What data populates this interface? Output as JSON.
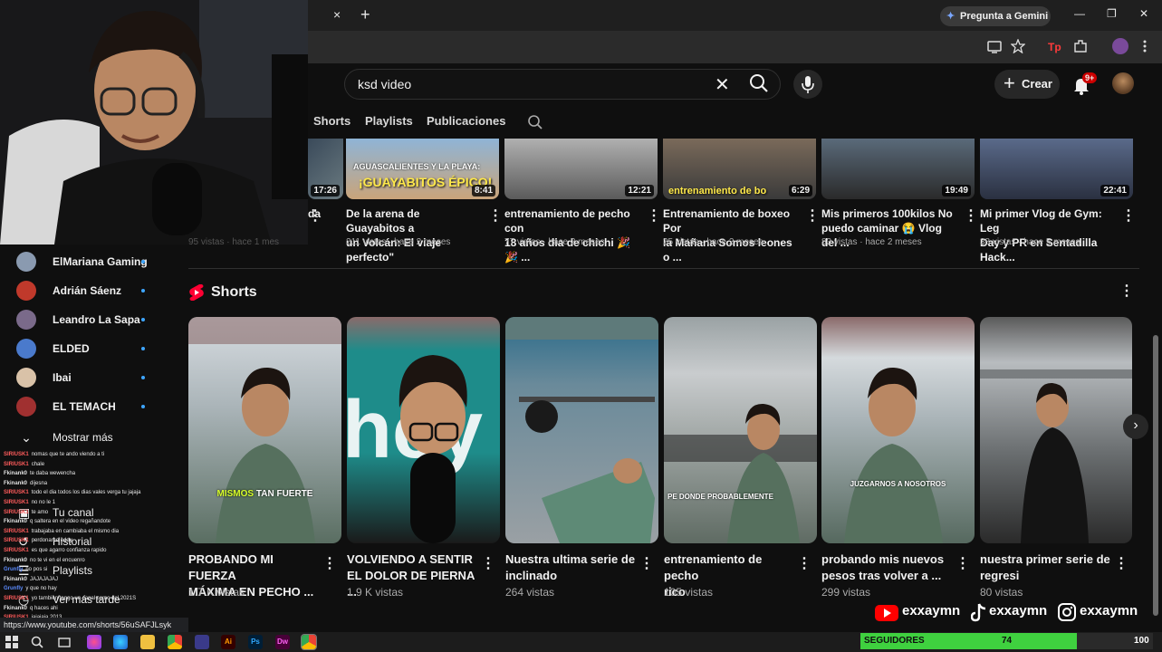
{
  "browser": {
    "new_tab": "+",
    "close_tab": "×",
    "gemini_label": "Pregunta a Gemini",
    "window_min": "—",
    "window_max": "❐",
    "window_close": "✕"
  },
  "youtube": {
    "search": {
      "value": "ksd video"
    },
    "create_label": "Crear",
    "notification_count": "9+",
    "channel_tabs": [
      "Shorts",
      "Playlists",
      "Publicaciones"
    ],
    "videos": [
      {
        "title_lines": [
          "",
          "da"
        ],
        "meta": "95 vistas · hace 1 mes",
        "duration": "17:26",
        "colors": [
          "#3a4a5a",
          "#6a7a80"
        ]
      },
      {
        "title_lines": [
          "De la arena de Guayabitos a",
          "un Volcán: El viaje perfecto\""
        ],
        "meta": "211 vistas · hace 2 meses",
        "duration": "8:41",
        "thumb_text_1": "AGUASCALIENTES Y LA PLAYA:",
        "thumb_text_2": "¡GUAYABITOS ÉPICO!",
        "colors": [
          "#8fb4d6",
          "#c9a47a"
        ]
      },
      {
        "title_lines": [
          "entrenamiento de pecho con",
          "18 años  dia de chichi 🎉 🎉 ..."
        ],
        "meta": "77 vistas · hace 2 meses",
        "duration": "12:21",
        "colors": [
          "#9a9a9a",
          "#5b5b5b"
        ]
      },
      {
        "title_lines": [
          "Entrenamiento de boxeo Por",
          "la Mañana Somos leones o ..."
        ],
        "meta": "25 vistas · hace 2 meses",
        "duration": "6:29",
        "thumb_text_1": "entrenamiento de bo",
        "colors": [
          "#7a6a5a",
          "#3a3a3a"
        ]
      },
      {
        "title_lines": [
          "Mis primeros 100kilos No",
          "puedo caminar 😭 Vlog del ..."
        ],
        "meta": "83 vistas · hace 2 meses",
        "duration": "19:49",
        "colors": [
          "#4a5a6a",
          "#2a2a2a"
        ]
      },
      {
        "title_lines": [
          "Mi primer Vlog de Gym: Leg",
          "Day y PR en Sentadilla Hack..."
        ],
        "meta": "38 vistas · hace 5 meses",
        "duration": "22:41",
        "colors": [
          "#5a6a8a",
          "#2a3040"
        ]
      }
    ],
    "shorts_heading": "Shorts",
    "shorts": [
      {
        "title_lines": [
          "PROBANDO MI FUERZA",
          "MÁXIMA EN PECHO ..."
        ],
        "views": "1.7 K vistas",
        "caption_a": "MISMOS",
        "caption_b": "TAN FUERTE",
        "colors": [
          "#d8dde2",
          "#5a6e62"
        ]
      },
      {
        "title_lines": [
          "VOLVIENDO A SENTIR",
          "EL DOLOR DE PIERNA ..."
        ],
        "views": "1.9 K vistas",
        "caption_a": "",
        "caption_b": "",
        "colors": [
          "#1e8c8a",
          "#1a1a1a"
        ]
      },
      {
        "title_lines": [
          "Nuestra ultima serie de",
          "inclinado"
        ],
        "views": "264 vistas",
        "caption_a": "",
        "caption_b": "",
        "colors": [
          "#2a6b8a",
          "#9aa0a4"
        ]
      },
      {
        "title_lines": [
          "entrenamiento de pecho",
          "rico"
        ],
        "views": "105 vistas",
        "caption_a": "",
        "caption_b": "PE DONDE PROBABLEMENTE",
        "colors": [
          "#c9ccce",
          "#5f6b63"
        ]
      },
      {
        "title_lines": [
          "probando mis nuevos",
          "pesos tras volver a ..."
        ],
        "views": "299 vistas",
        "caption_a": "",
        "caption_b": "JUZGARNOS A NOSOTROS",
        "colors": [
          "#d5dadd",
          "#56695f"
        ]
      },
      {
        "title_lines": [
          "nuestra primer serie de",
          "regresi"
        ],
        "views": "80 vistas",
        "caption_a": "",
        "caption_b": "",
        "colors": [
          "#b8bcbf",
          "#2a2a2a"
        ]
      }
    ]
  },
  "sidebar": {
    "subscriptions": [
      {
        "name": "ElMariana Gaming",
        "color": "#8a9ab0"
      },
      {
        "name": "Adrián Sáenz",
        "color": "#c0392b"
      },
      {
        "name": "Leandro La Sapa",
        "color": "#7a6a8a"
      },
      {
        "name": "ELDED",
        "color": "#4a7acc"
      },
      {
        "name": "Ibai",
        "color": "#d9c2a8"
      },
      {
        "name": "EL TEMACH",
        "color": "#a03030"
      }
    ],
    "show_more": "Mostrar más",
    "nav": [
      "Tu canal",
      "Historial",
      "Playlists",
      "Ver más tarde"
    ]
  },
  "chat": [
    {
      "user": "SIRIUSK1",
      "text": "nomas que te ando viendo a ti"
    },
    {
      "user": "SIRIUSK1",
      "text": "chale"
    },
    {
      "user": "Fkinank0",
      "text": "te daba wewencha"
    },
    {
      "user": "Fkinank0",
      "text": "dijesna"
    },
    {
      "user": "SIRIUSK1",
      "text": "todo el dia todos los dias vales verga tu jajaja"
    },
    {
      "user": "SIRIUSK1",
      "text": "no no le 1"
    },
    {
      "user": "SIRIUSK1",
      "text": "te amo"
    },
    {
      "user": "Fkinank0",
      "text": "q saltera en el video regañandote"
    },
    {
      "user": "SIRIUSK1",
      "text": "trabajaba en cambiaba el mismo dia"
    },
    {
      "user": "SIRIUSK1",
      "text": "perdoname eddy"
    },
    {
      "user": "SIRIUSK1",
      "text": "es que agarro confianza rapido"
    },
    {
      "user": "Fkinank0",
      "text": "no te vi en el encuenro"
    },
    {
      "user": "Grunfly",
      "text": "no pos si"
    },
    {
      "user": "Fkinank0",
      "text": "JAJAJAJAJ"
    },
    {
      "user": "Grunfly",
      "text": "y que no hay"
    },
    {
      "user": "SIRIUSK1",
      "text": "yo tambien tengo un canal como del 2021S"
    },
    {
      "user": "Fkinank0",
      "text": "q haces ahi"
    },
    {
      "user": "SIRIUSK1",
      "text": "jajajaja 2013"
    },
    {
      "user": "Fkinank0",
      "text": "JAJAJAJAJA"
    }
  ],
  "status_url": "https://www.youtube.com/shorts/56uSAFJLsyk",
  "overlay": {
    "socials": [
      "exxaymn",
      "exxaymn",
      "exxaymn"
    ],
    "followers_label": "SEGUIDORES",
    "followers_current": "74",
    "followers_goal": "100",
    "followers_fraction": 0.74
  },
  "taskbar": {
    "apps": [
      {
        "name": "Ai",
        "color": "#ff9a00",
        "bg": "#330000"
      },
      {
        "name": "Ps",
        "color": "#31a8ff",
        "bg": "#001e36"
      },
      {
        "name": "Dw",
        "color": "#ff61f6",
        "bg": "#470137"
      }
    ]
  }
}
